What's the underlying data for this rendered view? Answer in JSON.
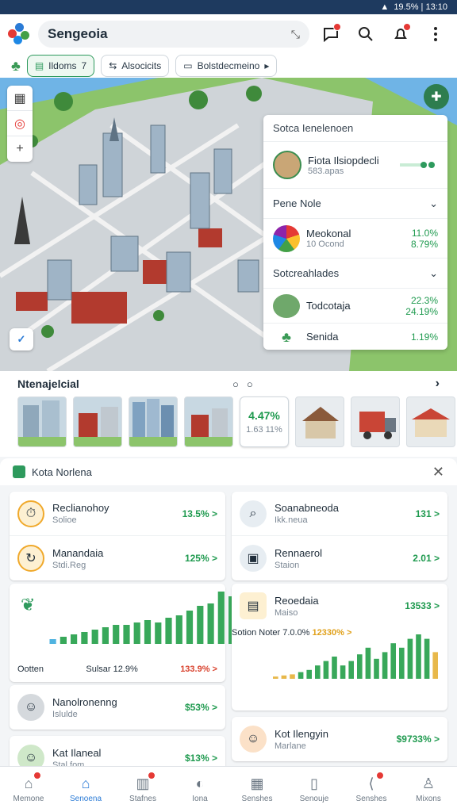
{
  "status": {
    "right_text": "19.5% | 13:10"
  },
  "appbar": {
    "title": "Sengeoia"
  },
  "filters": [
    {
      "label": "Ildoms",
      "suffix": "7"
    },
    {
      "label": "Alsocicits",
      "suffix": ""
    },
    {
      "label": "Bolstdecmeino",
      "suffix": "▸"
    }
  ],
  "panel": {
    "header": "Sotca Ienelenoen",
    "profile": {
      "name": "Fiota Ilsiopdecli",
      "sub": "583.apas"
    },
    "section1": {
      "label": "Pene Nole"
    },
    "row1": {
      "name": "Meokonal",
      "sub": "10 Ocond",
      "v1": "11.0%",
      "v2": "8.79%"
    },
    "section2": {
      "label": "Sotcreahlades"
    },
    "row2": {
      "name": "Todcotaja",
      "v1": "22.3%",
      "v2": "24.19%"
    },
    "row3": {
      "name": "Senida",
      "v1": "1.19%"
    }
  },
  "strip": {
    "title": "Ntenajelcial",
    "card_value": "4.47%",
    "card_sub": "1.63 11%"
  },
  "sheet": {
    "title": "Kota Norlena",
    "left": [
      {
        "name": "Reclianohoy",
        "sub": "Solioe",
        "value": "13.5% >"
      },
      {
        "name": "Manandaia",
        "sub": "Stdi.Reg",
        "value": "125% >"
      },
      {
        "name": "Nanolronenng",
        "sub": "Islulde",
        "value": "$53% >"
      },
      {
        "name": "Kat Ilaneal",
        "sub": "Stal.fom",
        "value": "$13% >"
      }
    ],
    "right": [
      {
        "name": "Soanabneoda",
        "sub": "Ikk.neua",
        "value": "131 >"
      },
      {
        "name": "Rennaerol",
        "sub": "Staion",
        "value": "2.01 >"
      },
      {
        "name": "Reoedaia",
        "sub": "Maiso",
        "value": "13533 >"
      },
      {
        "name": "Kot Ilengyin",
        "sub": "Marlane",
        "value": "$9733% >"
      }
    ],
    "left_chart_foot": {
      "a": "Ootten",
      "b": "Sulsar 12.9%",
      "c": "133.9% >"
    },
    "right_chart_foot": {
      "a": "Sotion",
      "b": "Noter 7.0.0%",
      "c": "12330% >"
    }
  },
  "chart_data": [
    {
      "type": "bar",
      "values": [
        2,
        3,
        4,
        5,
        6,
        7,
        8,
        8,
        9,
        10,
        9,
        11,
        12,
        14,
        16,
        17,
        22,
        20,
        14
      ]
    },
    {
      "type": "bar",
      "values": [
        1,
        1.5,
        2,
        3,
        4,
        6,
        8,
        10,
        6,
        8,
        11,
        14,
        9,
        12,
        16,
        14,
        18,
        20,
        18,
        12
      ]
    }
  ],
  "nav": [
    {
      "label": "Memone",
      "badge": true
    },
    {
      "label": "Senoena",
      "badge": false
    },
    {
      "label": "Stafnes",
      "badge": true
    },
    {
      "label": "Iona",
      "badge": false
    },
    {
      "label": "Senshes",
      "badge": false
    },
    {
      "label": "Senouje",
      "badge": false
    },
    {
      "label": "Senshes",
      "badge": true
    },
    {
      "label": "Mixons",
      "badge": false
    }
  ]
}
